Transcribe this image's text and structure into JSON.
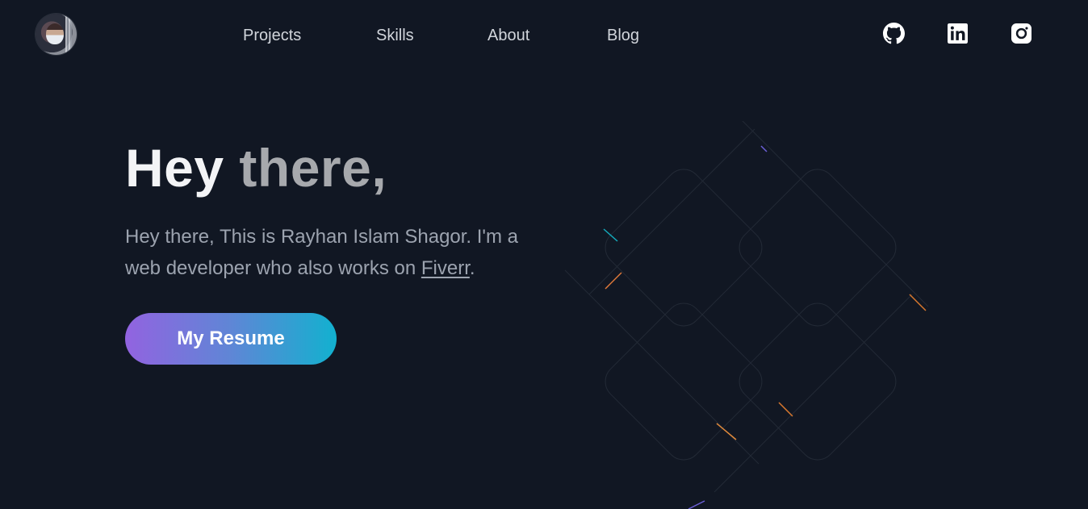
{
  "nav": {
    "avatar_alt": "Rayhan Islam Shagor avatar",
    "links": [
      {
        "label": "Projects"
      },
      {
        "label": "Skills"
      },
      {
        "label": "About"
      },
      {
        "label": "Blog"
      }
    ],
    "social": [
      {
        "icon": "github-icon"
      },
      {
        "icon": "linkedin-icon"
      },
      {
        "icon": "instagram-icon"
      }
    ]
  },
  "hero": {
    "title_word1": "Hey",
    "title_word2": "there,",
    "text_before_link": "Hey there, This is Rayhan Islam Shagor. I'm a web developer who also works on ",
    "link_text": "Fiverr",
    "text_after_link": ".",
    "button_label": "My Resume"
  },
  "colors": {
    "background": "#111723",
    "nav_text": "#d1d5db",
    "body_text": "#9ca3af",
    "button_gradient_start": "#9263e0",
    "button_gradient_end": "#12b1cf"
  }
}
